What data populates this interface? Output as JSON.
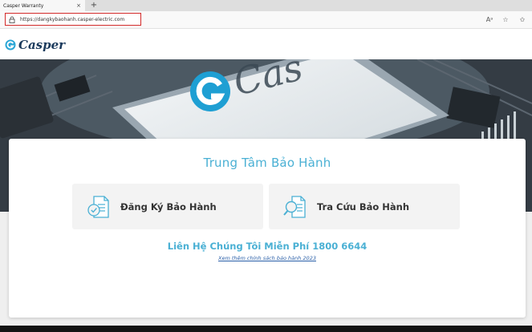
{
  "browser": {
    "tab_title": "Casper Warranty",
    "tab_close": "×",
    "new_tab": "+",
    "url": "https://dangkybaohanh.casper-electric.com",
    "tool_icons": [
      "Aᵃ",
      "☆",
      "✩"
    ]
  },
  "header": {
    "logo_text": "Casper"
  },
  "main": {
    "title": "Trung Tâm Bảo Hành",
    "options": [
      {
        "label": "Đăng Ký Bảo Hành",
        "icon": "register-document-check-icon"
      },
      {
        "label": "Tra Cứu Bảo Hành",
        "icon": "lookup-document-search-icon"
      }
    ],
    "contact": "Liên Hệ Chúng Tôi Miễn Phí 1800 6644",
    "policy_link": "Xem thêm chính sách bảo hành 2023"
  },
  "colors": {
    "accent": "#4ab0d4",
    "brand_dark": "#1b3a5c",
    "link": "#2a5fa8",
    "highlight_box": "#d32a2a"
  }
}
